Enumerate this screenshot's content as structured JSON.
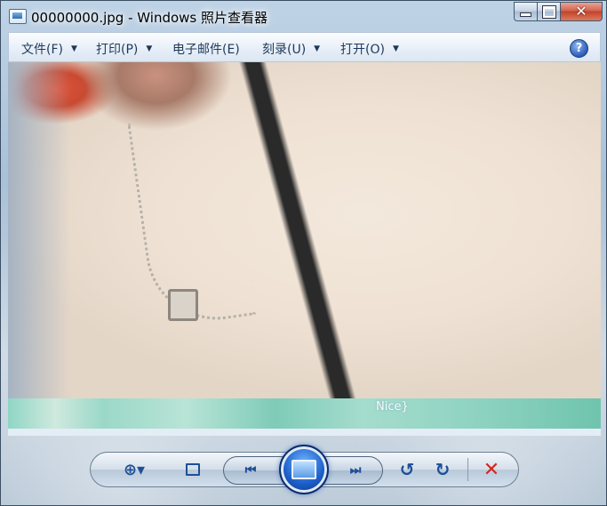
{
  "window": {
    "title": "00000000.jpg - Windows 照片查看器",
    "minimize_glyph": "",
    "close_glyph": "✕"
  },
  "menu": {
    "items": [
      {
        "label": "文件(F)"
      },
      {
        "label": "打印(P)"
      },
      {
        "label": "电子邮件(E)"
      },
      {
        "label": "刻录(U)"
      },
      {
        "label": "打开(O)"
      }
    ],
    "help_glyph": "?"
  },
  "image": {
    "overlay_text": "Nice}"
  },
  "toolbar": {
    "zoom_glyph": "⊕▾",
    "prev_glyph": "⏮",
    "next_glyph": "⏭",
    "rotate_left_glyph": "↺",
    "rotate_right_glyph": "↻",
    "delete_glyph": "✕"
  },
  "icons": {
    "app": "photo-viewer-icon",
    "help": "help-icon",
    "zoom": "zoom-icon",
    "fit": "actual-size-icon",
    "prev": "previous-icon",
    "slideshow": "slideshow-icon",
    "next": "next-icon",
    "rotate_left": "rotate-counterclockwise-icon",
    "rotate_right": "rotate-clockwise-icon",
    "delete": "delete-icon"
  }
}
